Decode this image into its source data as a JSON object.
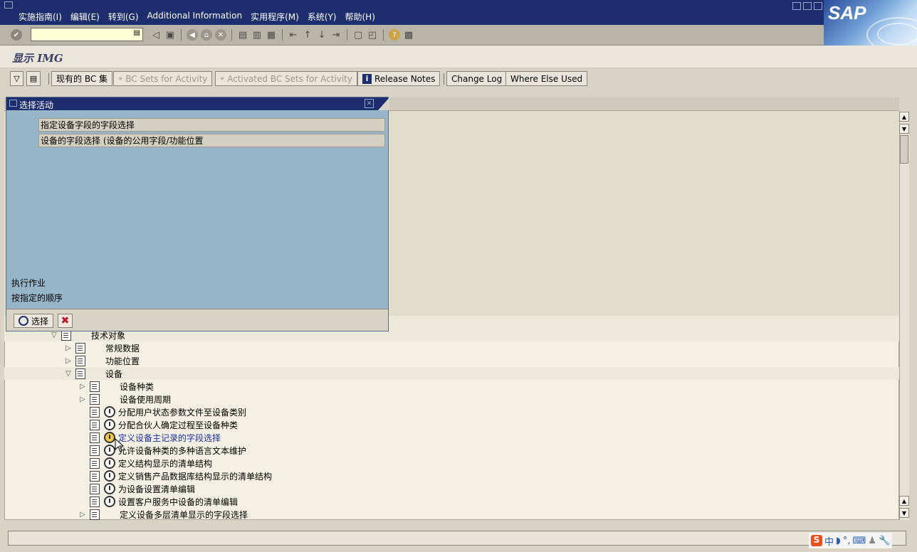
{
  "menubar": {
    "items": [
      "实施指南(I)",
      "编辑(E)",
      "转到(G)",
      "Additional Information",
      "实用程序(M)",
      "系统(Y)",
      "帮助(H)"
    ],
    "logo": "SAP"
  },
  "stdbar": {
    "command_value": ""
  },
  "screen": {
    "title": "显示 IMG"
  },
  "appbar": {
    "buttons": [
      "现有的 BC 集",
      "BC Sets for Activity",
      "Activated BC Sets for Activity",
      "Release Notes",
      "Change Log",
      "Where Else Used"
    ]
  },
  "popup": {
    "title": "选择活动",
    "items": [
      "指定设备字段的字段选择",
      "设备的字段选择 (设备的公用字段/功能位置"
    ],
    "info_line1": "执行作业",
    "info_line2": "按指定的顺序",
    "select_label": "选择"
  },
  "tree": {
    "items": [
      {
        "label": "技术对象",
        "expander": "▽"
      },
      {
        "label": "常规数据",
        "expander": "▷"
      },
      {
        "label": "功能位置",
        "expander": "▷"
      },
      {
        "label": "设备",
        "expander": "▽"
      },
      {
        "label": "设备种类",
        "expander": "▷"
      },
      {
        "label": "设备使用周期",
        "expander": "▷"
      },
      {
        "label": "分配用户状态参数文件至设备类别",
        "expander": ""
      },
      {
        "label": "分配合伙人确定过程至设备种类",
        "expander": ""
      },
      {
        "label": "定义设备主记录的字段选择",
        "expander": ""
      },
      {
        "label": "允许设备种类的多种语言文本维护",
        "expander": ""
      },
      {
        "label": "定义结构显示的清单结构",
        "expander": ""
      },
      {
        "label": "定义销售产品数据库结构显示的清单结构",
        "expander": ""
      },
      {
        "label": "为设备设置清单编辑",
        "expander": ""
      },
      {
        "label": "设置客户服务中设备的清单编辑",
        "expander": ""
      },
      {
        "label": "定义设备多层清单显示的字段选择",
        "expander": "▷"
      }
    ]
  },
  "ime": {
    "items": [
      "S",
      "中",
      "◗",
      "°,",
      "⌨",
      "♟",
      "🔧"
    ]
  },
  "colors": {
    "title_bar": "#1d2e6e",
    "popup_bg": "#97b5c9",
    "link": "#1a2fa5"
  }
}
